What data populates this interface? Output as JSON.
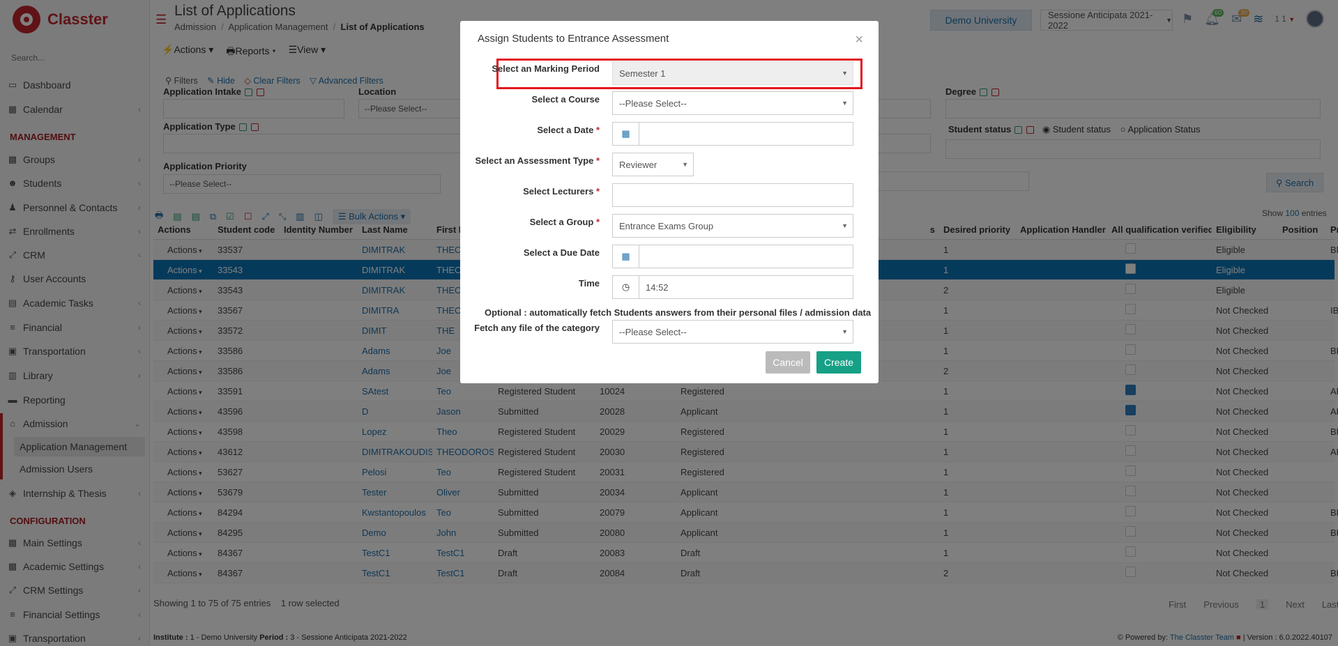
{
  "app": {
    "name": "Classter",
    "search_placeholder": "Search..."
  },
  "sidebar": {
    "items": [
      {
        "label": "Dashboard",
        "icon": "monitor-icon"
      },
      {
        "label": "Calendar",
        "icon": "calendar-icon"
      },
      {
        "label": "Groups",
        "icon": "groups-icon"
      },
      {
        "label": "Students",
        "icon": "students-icon"
      },
      {
        "label": "Personnel & Contacts",
        "icon": "personnel-icon"
      },
      {
        "label": "Enrollments",
        "icon": "enrollments-icon"
      },
      {
        "label": "CRM",
        "icon": "crm-icon"
      },
      {
        "label": "User Accounts",
        "icon": "key-icon"
      },
      {
        "label": "Academic Tasks",
        "icon": "tasks-icon"
      },
      {
        "label": "Financial",
        "icon": "coins-icon"
      },
      {
        "label": "Transportation",
        "icon": "bus-icon"
      },
      {
        "label": "Library",
        "icon": "library-icon"
      },
      {
        "label": "Reporting",
        "icon": "print-icon"
      },
      {
        "label": "Admission",
        "icon": "bank-icon"
      },
      {
        "label": "Internship & Thesis",
        "icon": "cube-icon"
      },
      {
        "label": "Main Settings",
        "icon": "settings-icon"
      },
      {
        "label": "Academic Settings",
        "icon": "settings-icon"
      },
      {
        "label": "CRM Settings",
        "icon": "crm-icon"
      },
      {
        "label": "Financial Settings",
        "icon": "coins-icon"
      },
      {
        "label": "Transportation",
        "icon": "bus-icon"
      }
    ],
    "sections": {
      "management": "MANAGEMENT",
      "configuration": "CONFIGURATION"
    },
    "admission_sub": [
      "Application Management",
      "Admission Users"
    ]
  },
  "header": {
    "title": "List of Applications",
    "breadcrumb": [
      "Admission",
      "Application Management",
      "List of Applications"
    ],
    "university": "Demo University",
    "session": "Sessione Anticipata 2021-2022",
    "badges": {
      "notifications": "60",
      "messages": "30"
    },
    "user": "1 1"
  },
  "toolbar": {
    "actions": "Actions",
    "reports": "Reports",
    "view": "View"
  },
  "filters": {
    "title": "Filters",
    "hide": "Hide",
    "clear": "Clear Filters",
    "advanced": "Advanced Filters",
    "application_intake": "Application Intake",
    "location": "Location",
    "location_value": "--Please Select--",
    "degree": "Degree",
    "application_type": "Application Type",
    "student_status": "Student status",
    "radio_student_status": "Student status",
    "radio_application_status": "Application Status",
    "application_priority": "Application Priority",
    "priority_value": "--Please Select--",
    "search_button": "Search"
  },
  "table": {
    "bulk_actions": "Bulk Actions",
    "show_label": "Show",
    "show_count": "100",
    "entries_label": "entries",
    "columns": [
      "Actions",
      "Student code",
      "Identity Number",
      "Last Name",
      "First N",
      "",
      "",
      "",
      "s",
      "Desired priority",
      "Application Handler",
      "All qualification verified",
      "Eligibility",
      "Position",
      "Program Abbr."
    ],
    "rows": [
      {
        "code": "33537",
        "last": "DIMITRAK",
        "first": "THEO",
        "status": "",
        "num": "",
        "type": "",
        "prio": "1",
        "verified": false,
        "elig": "Eligible",
        "prog": "BP",
        "sel": false
      },
      {
        "code": "33543",
        "last": "DIMITRAK",
        "first": "THEO",
        "status": "",
        "num": "",
        "type": "",
        "prio": "1",
        "verified": false,
        "elig": "Eligible",
        "prog": "",
        "sel": true
      },
      {
        "code": "33543",
        "last": "DIMITRAK",
        "first": "THEO",
        "status": "",
        "num": "",
        "type": "",
        "prio": "2",
        "verified": false,
        "elig": "Eligible",
        "prog": "",
        "sel": false
      },
      {
        "code": "33567",
        "last": "DIMITRA",
        "first": "THEO",
        "status": "",
        "num": "",
        "type": "",
        "prio": "1",
        "verified": false,
        "elig": "Not Checked",
        "prog": "IB",
        "sel": false
      },
      {
        "code": "33572",
        "last": "DIMIT",
        "first": "THE",
        "status": "",
        "num": "",
        "type": "",
        "prio": "1",
        "verified": false,
        "elig": "Not Checked",
        "prog": "",
        "sel": false
      },
      {
        "code": "33586",
        "last": "Adams",
        "first": "Joe",
        "status": "",
        "num": "",
        "type": "",
        "prio": "1",
        "verified": false,
        "elig": "Not Checked",
        "prog": "BP",
        "sel": false
      },
      {
        "code": "33586",
        "last": "Adams",
        "first": "Joe",
        "status": "",
        "num": "",
        "type": "",
        "prio": "2",
        "verified": false,
        "elig": "Not Checked",
        "prog": "",
        "sel": false
      },
      {
        "code": "33591",
        "last": "SAtest",
        "first": "Teo",
        "status": "Registered Student",
        "num": "10024",
        "type": "Registered",
        "prio": "1",
        "verified": true,
        "elig": "Not Checked",
        "prog": "ABC",
        "sel": false
      },
      {
        "code": "43596",
        "last": "D",
        "first": "Jason",
        "status": "Submitted",
        "num": "20028",
        "type": "Applicant",
        "prio": "1",
        "verified": true,
        "elig": "Not Checked",
        "prog": "ABC",
        "sel": false
      },
      {
        "code": "43598",
        "last": "Lopez",
        "first": "Theo",
        "status": "Registered Student",
        "num": "20029",
        "type": "Registered",
        "prio": "1",
        "verified": false,
        "elig": "Not Checked",
        "prog": "BP",
        "sel": false
      },
      {
        "code": "43612",
        "last": "DIMITRAKOUDIS",
        "first": "THEODOROS",
        "status": "Registered Student",
        "num": "20030",
        "type": "Registered",
        "prio": "1",
        "verified": false,
        "elig": "Not Checked",
        "prog": "ABC",
        "sel": false
      },
      {
        "code": "53627",
        "last": "Pelosi",
        "first": "Teo",
        "status": "Registered Student",
        "num": "20031",
        "type": "Registered",
        "prio": "1",
        "verified": false,
        "elig": "Not Checked",
        "prog": "",
        "sel": false
      },
      {
        "code": "53679",
        "last": "Tester",
        "first": "Oliver",
        "status": "Submitted",
        "num": "20034",
        "type": "Applicant",
        "prio": "1",
        "verified": false,
        "elig": "Not Checked",
        "prog": "",
        "sel": false
      },
      {
        "code": "84294",
        "last": "Kwstantopoulos",
        "first": "Teo",
        "status": "Submitted",
        "num": "20079",
        "type": "Applicant",
        "prio": "1",
        "verified": false,
        "elig": "Not Checked",
        "prog": "BP",
        "sel": false
      },
      {
        "code": "84295",
        "last": "Demo",
        "first": "John",
        "status": "Submitted",
        "num": "20080",
        "type": "Applicant",
        "prio": "1",
        "verified": false,
        "elig": "Not Checked",
        "prog": "BP",
        "sel": false
      },
      {
        "code": "84367",
        "last": "TestC1",
        "first": "TestC1",
        "status": "Draft",
        "num": "20083",
        "type": "Draft",
        "prio": "1",
        "verified": false,
        "elig": "Not Checked",
        "prog": "",
        "sel": false
      },
      {
        "code": "84367",
        "last": "TestC1",
        "first": "TestC1",
        "status": "Draft",
        "num": "20084",
        "type": "Draft",
        "prio": "2",
        "verified": false,
        "elig": "Not Checked",
        "prog": "BP",
        "sel": false
      }
    ],
    "actions_label": "Actions",
    "info": "Showing 1 to 75 of 75 entries",
    "selected": "1 row selected",
    "pager": [
      "First",
      "Previous",
      "1",
      "Next",
      "Last"
    ]
  },
  "bottom": {
    "institute_label": "Institute :",
    "institute_value": "1 - Demo University",
    "period_label": "Period :",
    "period_value": "3 - Sessione Anticipata 2021-2022",
    "powered": "Powered by:",
    "team": "The Classter Team",
    "version": "| Version : 6.0.2022.40107"
  },
  "modal": {
    "title": "Assign Students to Entrance Assessment",
    "marking_period_label": "Select an Marking Period",
    "marking_period_value": "Semester 1",
    "course_label": "Select a Course",
    "course_value": "--Please Select--",
    "date_label": "Select a Date",
    "date_value": "",
    "assessment_type_label": "Select an Assessment Type",
    "assessment_type_value": "Reviewer",
    "lecturers_label": "Select Lecturers",
    "lecturers_value": "",
    "group_label": "Select a Group",
    "group_value": "Entrance Exams Group",
    "due_date_label": "Select a Due Date",
    "due_date_value": "",
    "time_label": "Time",
    "time_value": "14:52",
    "optional_text": "Optional : automatically fetch Students answers from their personal files / admission data",
    "fetch_label": "Fetch any file of the category",
    "fetch_value": "--Please Select--",
    "cancel": "Cancel",
    "create": "Create",
    "required_mark": "*"
  }
}
